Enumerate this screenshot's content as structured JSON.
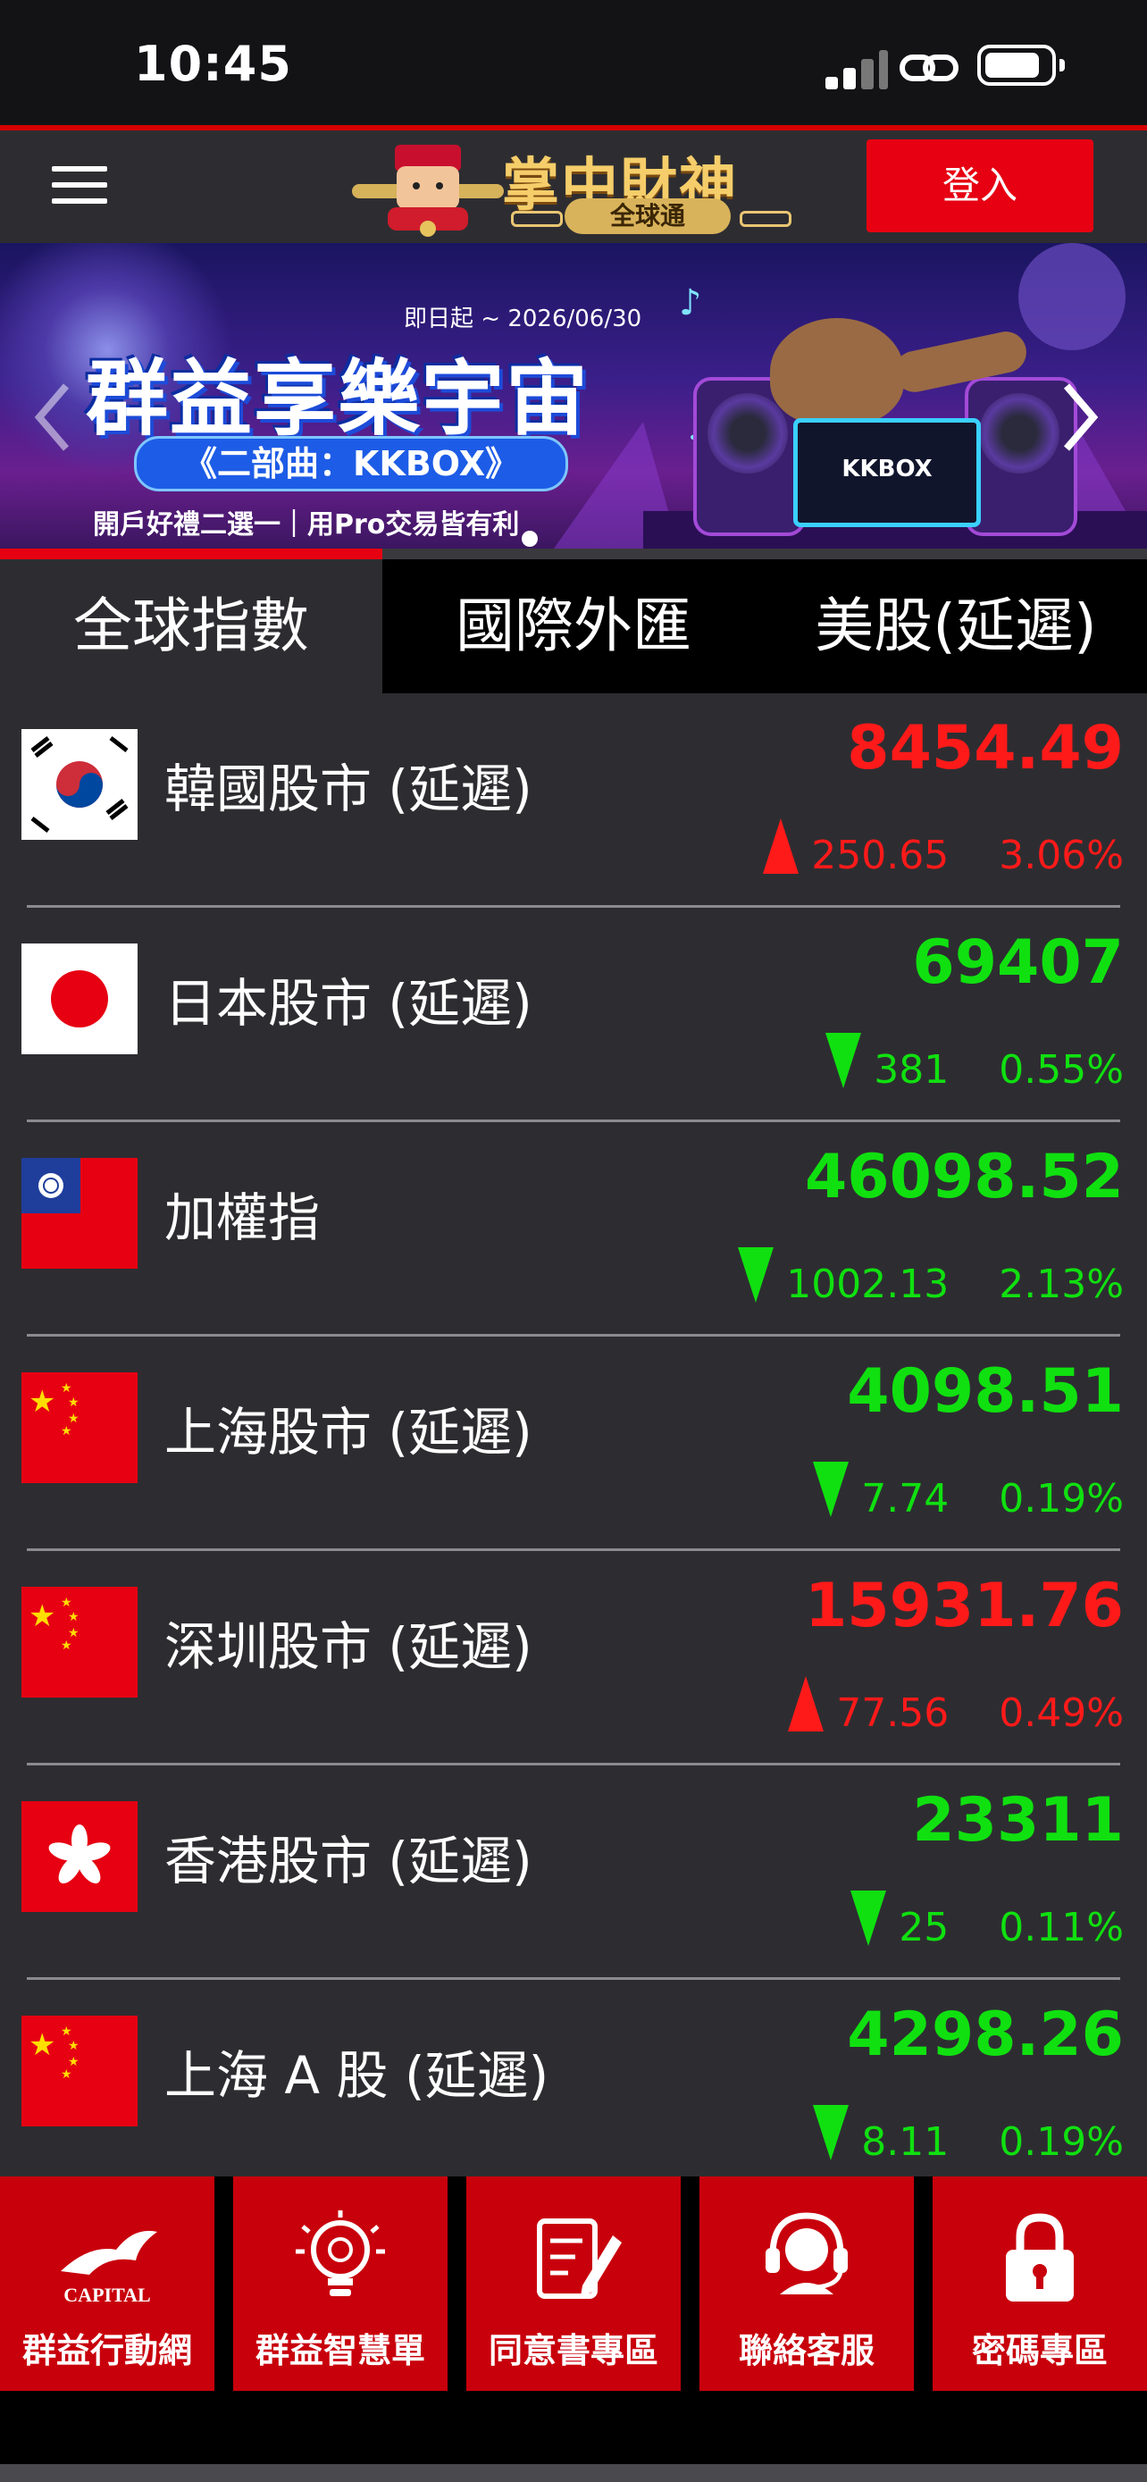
{
  "status_bar": {
    "time": "10:45"
  },
  "header": {
    "logo_text": "掌中財神",
    "logo_subtext": "全球通",
    "login_label": "登入"
  },
  "banner": {
    "date_text": "即日起 ~ 2026/06/30",
    "title": "群益享樂宇宙",
    "subtitle": "《二部曲：KKBOX》",
    "footer": "開戶好禮二選一｜用Pro交易皆有利",
    "device_text": "KKBOX"
  },
  "tabs": [
    {
      "label": "全球指數",
      "active": true
    },
    {
      "label": "國際外匯",
      "active": false
    },
    {
      "label": "美股(延遲)",
      "active": false
    }
  ],
  "indices": [
    {
      "name": "韓國股市 (延遲)",
      "price": "8454.49",
      "change": "250.65",
      "percent": "3.06%",
      "direction": "up",
      "flag": "korea-flag-icon"
    },
    {
      "name": "日本股市 (延遲)",
      "price": "69407",
      "change": "381",
      "percent": "0.55%",
      "direction": "down",
      "flag": "japan-flag-icon"
    },
    {
      "name": "加權指",
      "price": "46098.52",
      "change": "1002.13",
      "percent": "2.13%",
      "direction": "down",
      "flag": "taiwan-flag-icon"
    },
    {
      "name": "上海股市 (延遲)",
      "price": "4098.51",
      "change": "7.74",
      "percent": "0.19%",
      "direction": "down",
      "flag": "china-flag-icon"
    },
    {
      "name": "深圳股市 (延遲)",
      "price": "15931.76",
      "change": "77.56",
      "percent": "0.49%",
      "direction": "up",
      "flag": "china-flag-icon"
    },
    {
      "name": "香港股市 (延遲)",
      "price": "23311",
      "change": "25",
      "percent": "0.11%",
      "direction": "down",
      "flag": "hongkong-flag-icon"
    },
    {
      "name": "上海 A 股 (延遲)",
      "price": "4298.26",
      "change": "8.11",
      "percent": "0.19%",
      "direction": "down",
      "flag": "china-flag-icon"
    }
  ],
  "bottom_nav": [
    {
      "label": "群益行動網",
      "icon": "capital-logo-icon",
      "icon_text": "CAPITAL"
    },
    {
      "label": "群益智慧單",
      "icon": "lightbulb-icon"
    },
    {
      "label": "同意書專區",
      "icon": "document-pen-icon"
    },
    {
      "label": "聯絡客服",
      "icon": "headset-icon"
    },
    {
      "label": "密碼專區",
      "icon": "lock-icon"
    }
  ],
  "colors": {
    "up": "#ff1a1a",
    "down": "#10e010",
    "accent": "#e60012",
    "list_bg": "#2d2d31"
  }
}
